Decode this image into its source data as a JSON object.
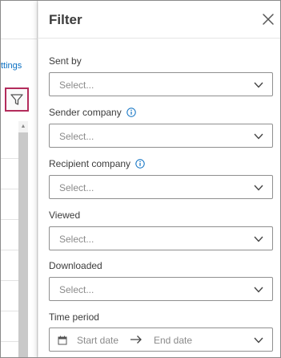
{
  "background": {
    "settings_link": "ttings"
  },
  "filter_panel": {
    "title": "Filter",
    "fields": [
      {
        "label": "Sent by",
        "placeholder": "Select...",
        "info": false
      },
      {
        "label": "Sender company",
        "placeholder": "Select...",
        "info": true
      },
      {
        "label": "Recipient company",
        "placeholder": "Select...",
        "info": true
      },
      {
        "label": "Viewed",
        "placeholder": "Select...",
        "info": false
      },
      {
        "label": "Downloaded",
        "placeholder": "Select...",
        "info": false
      }
    ],
    "time_period": {
      "label": "Time period",
      "start_placeholder": "Start date",
      "end_placeholder": "End date"
    }
  },
  "colors": {
    "link": "#0a6fc2",
    "filter_button_border": "#b32c5c",
    "info_icon": "#0a6fc2"
  }
}
